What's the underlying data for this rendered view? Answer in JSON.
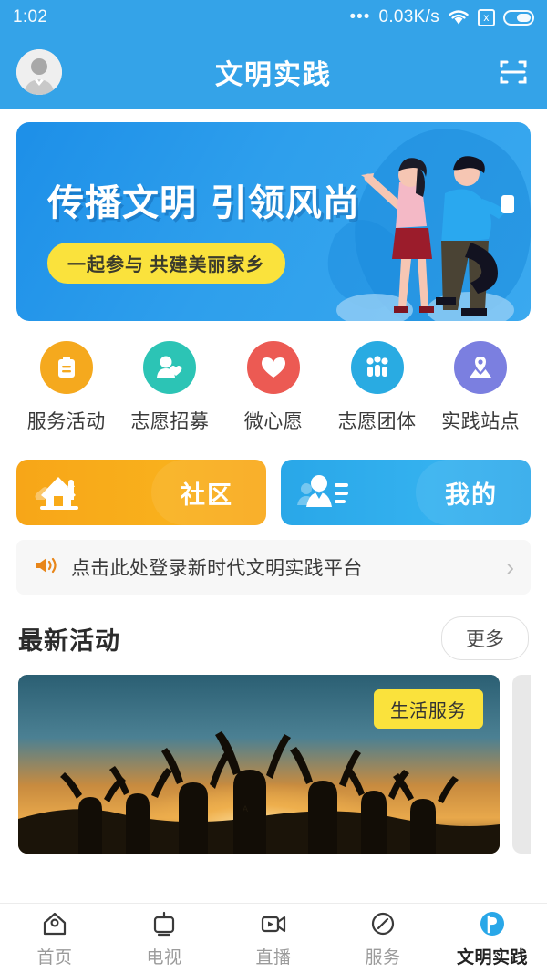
{
  "status_bar": {
    "time": "1:02",
    "dots": "•••",
    "network_speed": "0.03K/s",
    "wifi_icon": "wifi-icon",
    "sim_icon": "no-sim-icon",
    "sim_glyph": "x",
    "battery_icon": "battery-icon"
  },
  "header": {
    "title": "文明实践",
    "avatar_name": "user-avatar",
    "scan_icon": "scan-qr-icon"
  },
  "banner": {
    "headline": "传播文明 引领风尚",
    "subline": "一起参与 共建美丽家乡",
    "bg_color": "#2e9fec",
    "pill_color": "#FAE23C"
  },
  "quick_actions": [
    {
      "label": "服务活动",
      "icon": "clipboard-icon",
      "color": "#F5A91E"
    },
    {
      "label": "志愿招募",
      "icon": "person-heart-icon",
      "color": "#2CC4B5"
    },
    {
      "label": "微心愿",
      "icon": "heart-icon",
      "color": "#EC5A53"
    },
    {
      "label": "志愿团体",
      "icon": "group-people-icon",
      "color": "#29ABE2"
    },
    {
      "label": "实践站点",
      "icon": "map-pin-icon",
      "color": "#7B7FE0"
    }
  ],
  "duo_cards": [
    {
      "label": "社区",
      "icon": "house-icon",
      "color": "#F9AB19"
    },
    {
      "label": "我的",
      "icon": "user-profile-icon",
      "color": "#2FAAEB"
    }
  ],
  "notice": {
    "icon": "speaker-icon",
    "text": "点击此处登录新时代文明实践平台",
    "arrow": "›"
  },
  "activity_section": {
    "title": "最新活动",
    "more_label": "更多",
    "cards": [
      {
        "badge": "生活服务",
        "image_alt": "people-raising-arms-sunset-photo"
      }
    ]
  },
  "tabbar": [
    {
      "label": "首页",
      "icon": "home-icon",
      "active": false
    },
    {
      "label": "电视",
      "icon": "tv-icon",
      "active": false
    },
    {
      "label": "直播",
      "icon": "live-video-icon",
      "active": false
    },
    {
      "label": "服务",
      "icon": "compass-icon",
      "active": false
    },
    {
      "label": "文明实践",
      "icon": "flag-icon",
      "active": true
    }
  ],
  "colors": {
    "brand_blue": "#34A3E8",
    "accent_yellow": "#FAE23C",
    "accent_orange": "#F9AB19"
  }
}
